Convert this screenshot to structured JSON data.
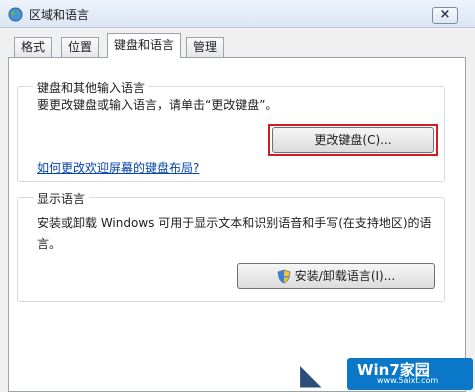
{
  "window": {
    "title": "区域和语言",
    "close_symbol": "×"
  },
  "tabs": [
    {
      "label": "格式",
      "active": false
    },
    {
      "label": "位置",
      "active": false
    },
    {
      "label": "键盘和语言",
      "active": true
    },
    {
      "label": "管理",
      "active": false
    }
  ],
  "keyboard_group": {
    "title": "键盘和其他输入语言",
    "description": "要更改键盘或输入语言，请单击“更改键盘”。",
    "change_button": "更改键盘(C)...",
    "link": "如何更改欢迎屏幕的键盘布局?"
  },
  "display_group": {
    "title": "显示语言",
    "description_line1": "安装或卸载 Windows 可用于显示文本和识别语音和手写(在支持地区)的语",
    "description_line2": "言。",
    "install_button": "安装/卸载语言(I)..."
  },
  "watermark": {
    "brand": "Win7家园",
    "url": "www.5aixt.com"
  },
  "colors": {
    "highlight": "#d11c24",
    "link": "#0645ad",
    "watermark": "#0b77c9"
  },
  "icons": {
    "app": "globe-icon",
    "shield": "uac-shield-icon",
    "close": "close-icon"
  }
}
